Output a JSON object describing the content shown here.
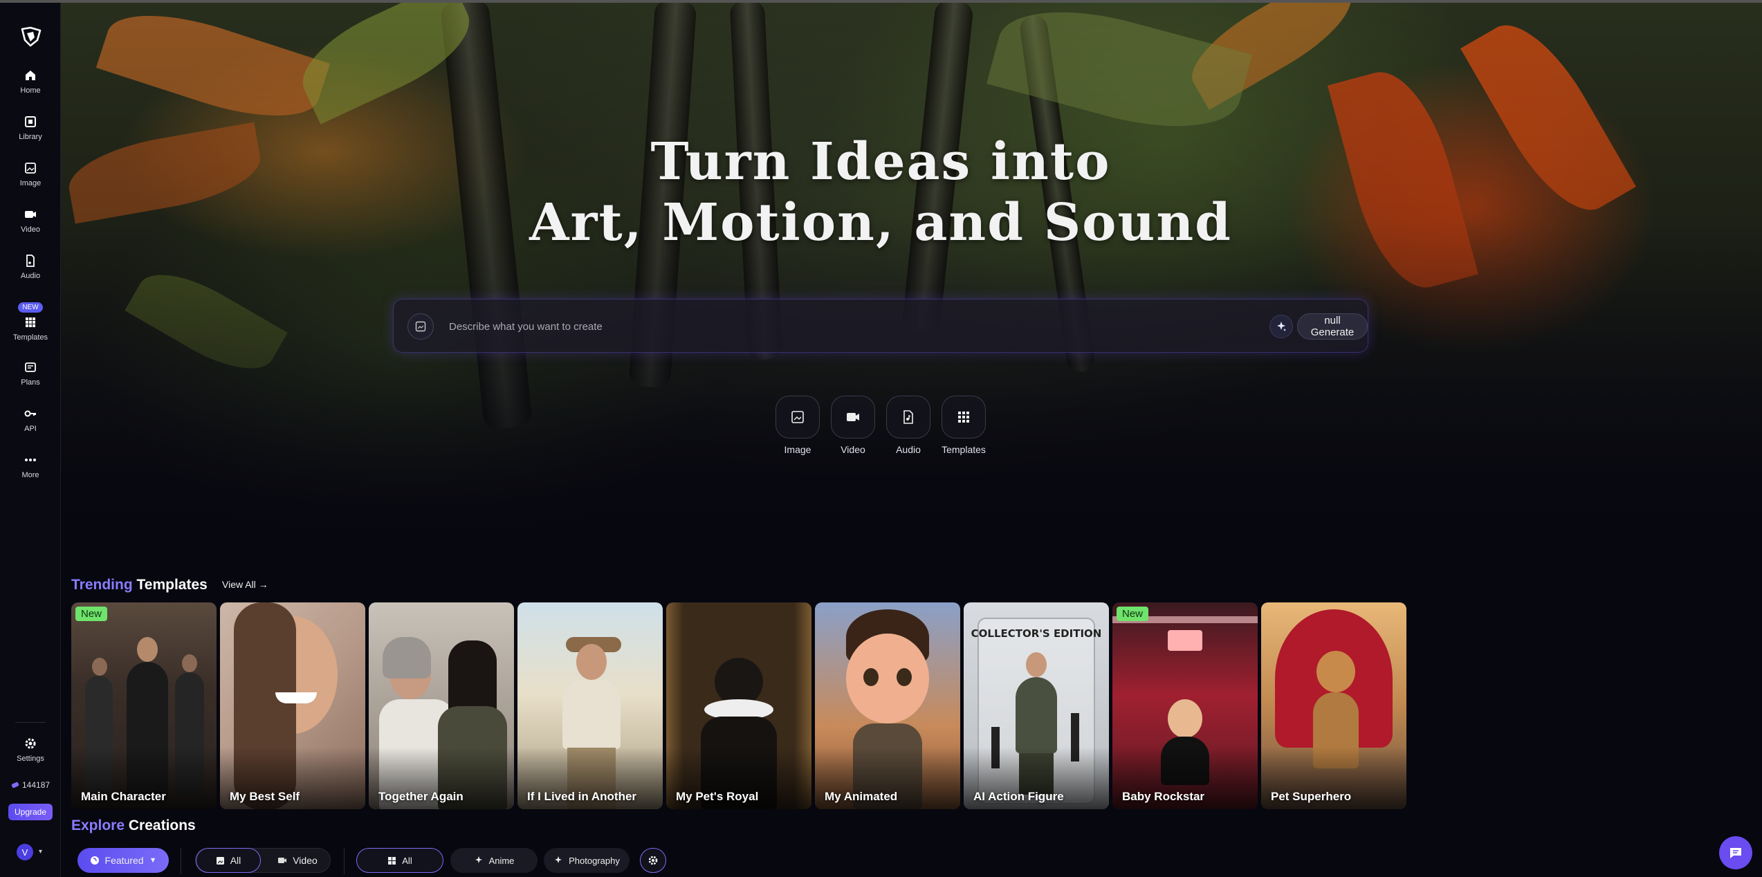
{
  "sidebar": {
    "items": [
      {
        "label": "Home",
        "icon": "home-icon"
      },
      {
        "label": "Library",
        "icon": "library-icon"
      },
      {
        "label": "Image",
        "icon": "image-icon"
      },
      {
        "label": "Video",
        "icon": "video-icon"
      },
      {
        "label": "Audio",
        "icon": "audio-icon"
      },
      {
        "label": "Templates",
        "icon": "grid-icon",
        "badge": "NEW"
      },
      {
        "label": "Plans",
        "icon": "plans-icon"
      },
      {
        "label": "API",
        "icon": "key-icon"
      },
      {
        "label": "More",
        "icon": "more-icon"
      }
    ],
    "settings_label": "Settings",
    "credits": "144187",
    "upgrade_label": "Upgrade",
    "avatar_initial": "V"
  },
  "hero": {
    "title_line1": "Turn Ideas into",
    "title_line2": "Art, Motion, and Sound",
    "prompt_placeholder": "Describe what you want to create",
    "generate_label": "null Generate",
    "quick_actions": [
      {
        "label": "Image",
        "icon": "image-icon"
      },
      {
        "label": "Video",
        "icon": "video-icon"
      },
      {
        "label": "Audio",
        "icon": "audio-icon"
      },
      {
        "label": "Templates",
        "icon": "grid-icon"
      }
    ]
  },
  "trending": {
    "title_accent": "Trending",
    "title_rest": "Templates",
    "view_all": "View All →",
    "cards": [
      {
        "label": "Main Character",
        "badge": "New"
      },
      {
        "label": "My Best Self",
        "badge": ""
      },
      {
        "label": "Together Again",
        "badge": ""
      },
      {
        "label": "If I Lived in Another",
        "badge": ""
      },
      {
        "label": "My Pet's Royal",
        "badge": ""
      },
      {
        "label": "My Animated",
        "badge": ""
      },
      {
        "label": "AI Action Figure",
        "badge": "",
        "packaging_text": "COLLECTOR'S EDITION"
      },
      {
        "label": "Baby Rockstar",
        "badge": "New"
      },
      {
        "label": "Pet Superhero",
        "badge": ""
      }
    ]
  },
  "explore": {
    "title_accent": "Explore",
    "title_rest": "Creations",
    "sort_label": "Featured",
    "media_filters": [
      "All",
      "Video"
    ],
    "style_filters": [
      "All",
      "Anime",
      "Photography"
    ]
  },
  "colors": {
    "accent": "#8a7cff",
    "new_badge": "#6fe36b",
    "upgrade": "#5b4cf0"
  }
}
